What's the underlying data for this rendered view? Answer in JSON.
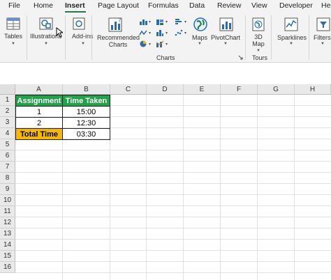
{
  "tabs": [
    "File",
    "Home",
    "Insert",
    "Page Layout",
    "Formulas",
    "Data",
    "Review",
    "View",
    "Developer",
    "He"
  ],
  "active_tab": "Insert",
  "ribbon": {
    "tables": "Tables",
    "illustrations": "Illustrations",
    "addins": "Add-ins",
    "recommended_charts": "Recommended Charts",
    "charts_group": "Charts",
    "maps": "Maps",
    "pivotchart": "PivotChart",
    "map3d": "3D Map",
    "tours_group": "Tours",
    "sparklines": "Sparklines",
    "filters": "Filters"
  },
  "columns": [
    "A",
    "B",
    "C",
    "D",
    "E",
    "F",
    "G",
    "H"
  ],
  "rows": [
    "1",
    "2",
    "3",
    "4",
    "5",
    "6",
    "7",
    "8",
    "9",
    "10",
    "11",
    "12",
    "13",
    "14",
    "15",
    "16"
  ],
  "cells": {
    "a1": "Assignment",
    "b1": "Time Taken",
    "a2": "1",
    "b2": "15:00",
    "a3": "2",
    "b3": "12:30",
    "a4": "Total Time",
    "b4": "03:30"
  },
  "colors": {
    "header_fill": "#1fa24a",
    "total_fill": "#f5b800",
    "accent": "#1f7a44"
  }
}
